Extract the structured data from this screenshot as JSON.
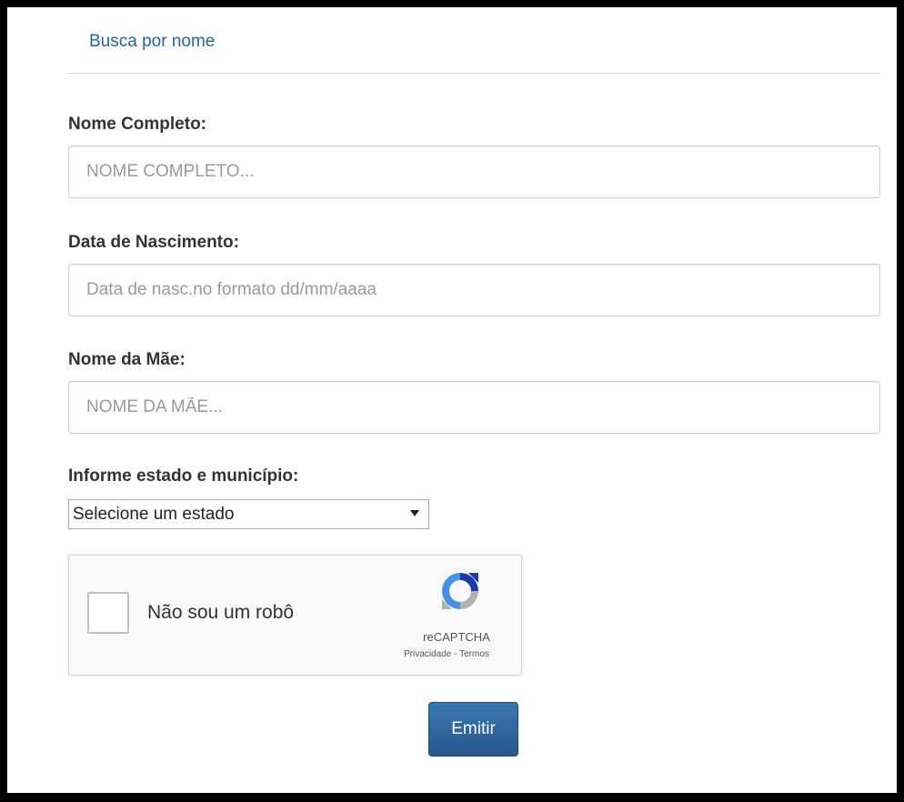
{
  "tab": {
    "label": "Busca por nome"
  },
  "fields": {
    "full_name": {
      "label": "Nome Completo:",
      "placeholder": "NOME COMPLETO...",
      "value": ""
    },
    "birth_date": {
      "label": "Data de Nascimento:",
      "placeholder": "Data de nasc.no formato dd/mm/aaaa",
      "value": ""
    },
    "mother_name": {
      "label": "Nome da Mãe:",
      "placeholder": "NOME DA MÃE...",
      "value": ""
    }
  },
  "location": {
    "label": "Informe estado e município:",
    "selected": "Selecione um estado"
  },
  "captcha": {
    "label": "Não sou um robô",
    "brand": "reCAPTCHA",
    "privacy": "Privacidade",
    "separator": " - ",
    "terms": "Termos",
    "icon": "recaptcha-logo-icon"
  },
  "submit": {
    "label": "Emitir"
  },
  "colors": {
    "link": "#2a6496",
    "button": "#285e8e",
    "captcha_blue": "#1c3aa9",
    "captcha_light_blue": "#4a90e2",
    "captcha_gray": "#b1b1b1"
  }
}
